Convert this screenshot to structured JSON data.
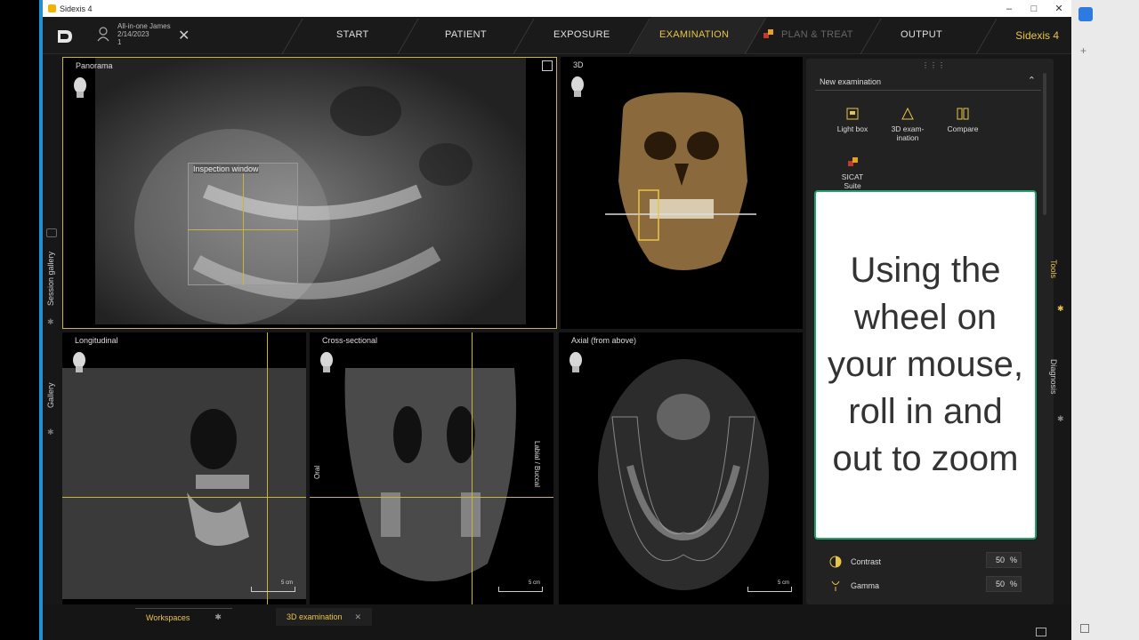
{
  "window": {
    "title": "Sidexis 4"
  },
  "patient": {
    "name": "All-in-one James",
    "date": "2/14/2023",
    "id": "1"
  },
  "nav": {
    "tabs": [
      "START",
      "PATIENT",
      "EXPOSURE",
      "EXAMINATION",
      "PLAN & TREAT",
      "OUTPUT"
    ],
    "active": "EXAMINATION",
    "brand": "Sidexis 4"
  },
  "viewports": {
    "panorama": {
      "label": "Panorama",
      "inspection": "Inspection window"
    },
    "three_d": {
      "label": "3D"
    },
    "longitudinal": {
      "label": "Longitudinal",
      "scale": "5 cm"
    },
    "cross": {
      "label": "Cross-sectional",
      "oral": "Oral",
      "buccal": "Labial / Buccal",
      "scale": "5 cm"
    },
    "axial": {
      "label": "Axial (from above)",
      "scale": "5 cm"
    }
  },
  "left_sidebar": {
    "session_gallery": "Session gallery",
    "gallery": "Gallery"
  },
  "right_tabs": {
    "tools": "Tools",
    "diagnosis": "Diagnosis"
  },
  "panel": {
    "section": "New examination",
    "tools": [
      {
        "label": "Light box"
      },
      {
        "label": "3D exam-\nination"
      },
      {
        "label": "Compare"
      },
      {
        "label": "SICAT\nSuite"
      }
    ],
    "overlay_text": "Using the wheel on your mouse, roll in and out to zoom",
    "contrast": {
      "label": "Contrast",
      "value": "50",
      "unit": "%"
    },
    "gamma": {
      "label": "Gamma",
      "value": "50",
      "unit": "%"
    }
  },
  "bottom": {
    "workspaces": "Workspaces",
    "exam_tab": "3D examination"
  },
  "colors": {
    "accent": "#e8c547",
    "overlay_border": "#26a06a"
  }
}
